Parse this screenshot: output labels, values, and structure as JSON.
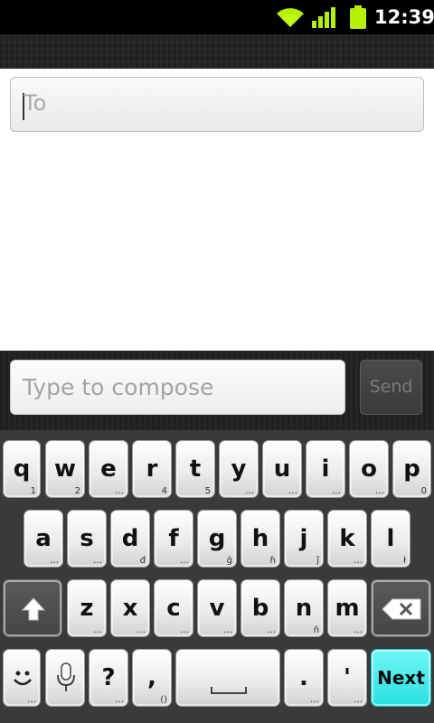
{
  "status_bar": {
    "time": "12:39",
    "icons": [
      "wifi-icon",
      "signal-icon",
      "battery-icon"
    ],
    "accent_color": "#b6f000"
  },
  "recipient": {
    "placeholder": "To"
  },
  "compose": {
    "placeholder": "Type to compose",
    "send_label": "Send"
  },
  "keyboard": {
    "row1": [
      {
        "label": "q",
        "sub": "1"
      },
      {
        "label": "w",
        "sub": "2"
      },
      {
        "label": "e",
        "sub": "…"
      },
      {
        "label": "r",
        "sub": "4"
      },
      {
        "label": "t",
        "sub": "5"
      },
      {
        "label": "y",
        "sub": "…"
      },
      {
        "label": "u",
        "sub": "…"
      },
      {
        "label": "i",
        "sub": "…"
      },
      {
        "label": "o",
        "sub": "…"
      },
      {
        "label": "p",
        "sub": "0"
      }
    ],
    "row2": [
      {
        "label": "a",
        "sub": "…"
      },
      {
        "label": "s",
        "sub": "…"
      },
      {
        "label": "d",
        "sub": "đ"
      },
      {
        "label": "f",
        "sub": "…"
      },
      {
        "label": "g",
        "sub": "ğ"
      },
      {
        "label": "h",
        "sub": "ɦ"
      },
      {
        "label": "j",
        "sub": "ĵ"
      },
      {
        "label": "k",
        "sub": "…"
      },
      {
        "label": "l",
        "sub": "ł"
      }
    ],
    "row3": [
      {
        "label": "z",
        "sub": "…"
      },
      {
        "label": "x",
        "sub": "…"
      },
      {
        "label": "c",
        "sub": "…"
      },
      {
        "label": "v",
        "sub": "…"
      },
      {
        "label": "b",
        "sub": "…"
      },
      {
        "label": "n",
        "sub": "ñ"
      },
      {
        "label": "m",
        "sub": "…"
      }
    ],
    "shift_icon": "shift-icon",
    "backspace_icon": "backspace-icon",
    "row4": {
      "question": {
        "label": "?",
        "sub": "…"
      },
      "comma": {
        "label": ",",
        "sub": "()"
      },
      "period": {
        "label": ".",
        "sub": "…"
      },
      "apostrophe": {
        "label": "'",
        "sub": "…"
      },
      "next": "Next",
      "next_color": "#33e6e6"
    }
  }
}
